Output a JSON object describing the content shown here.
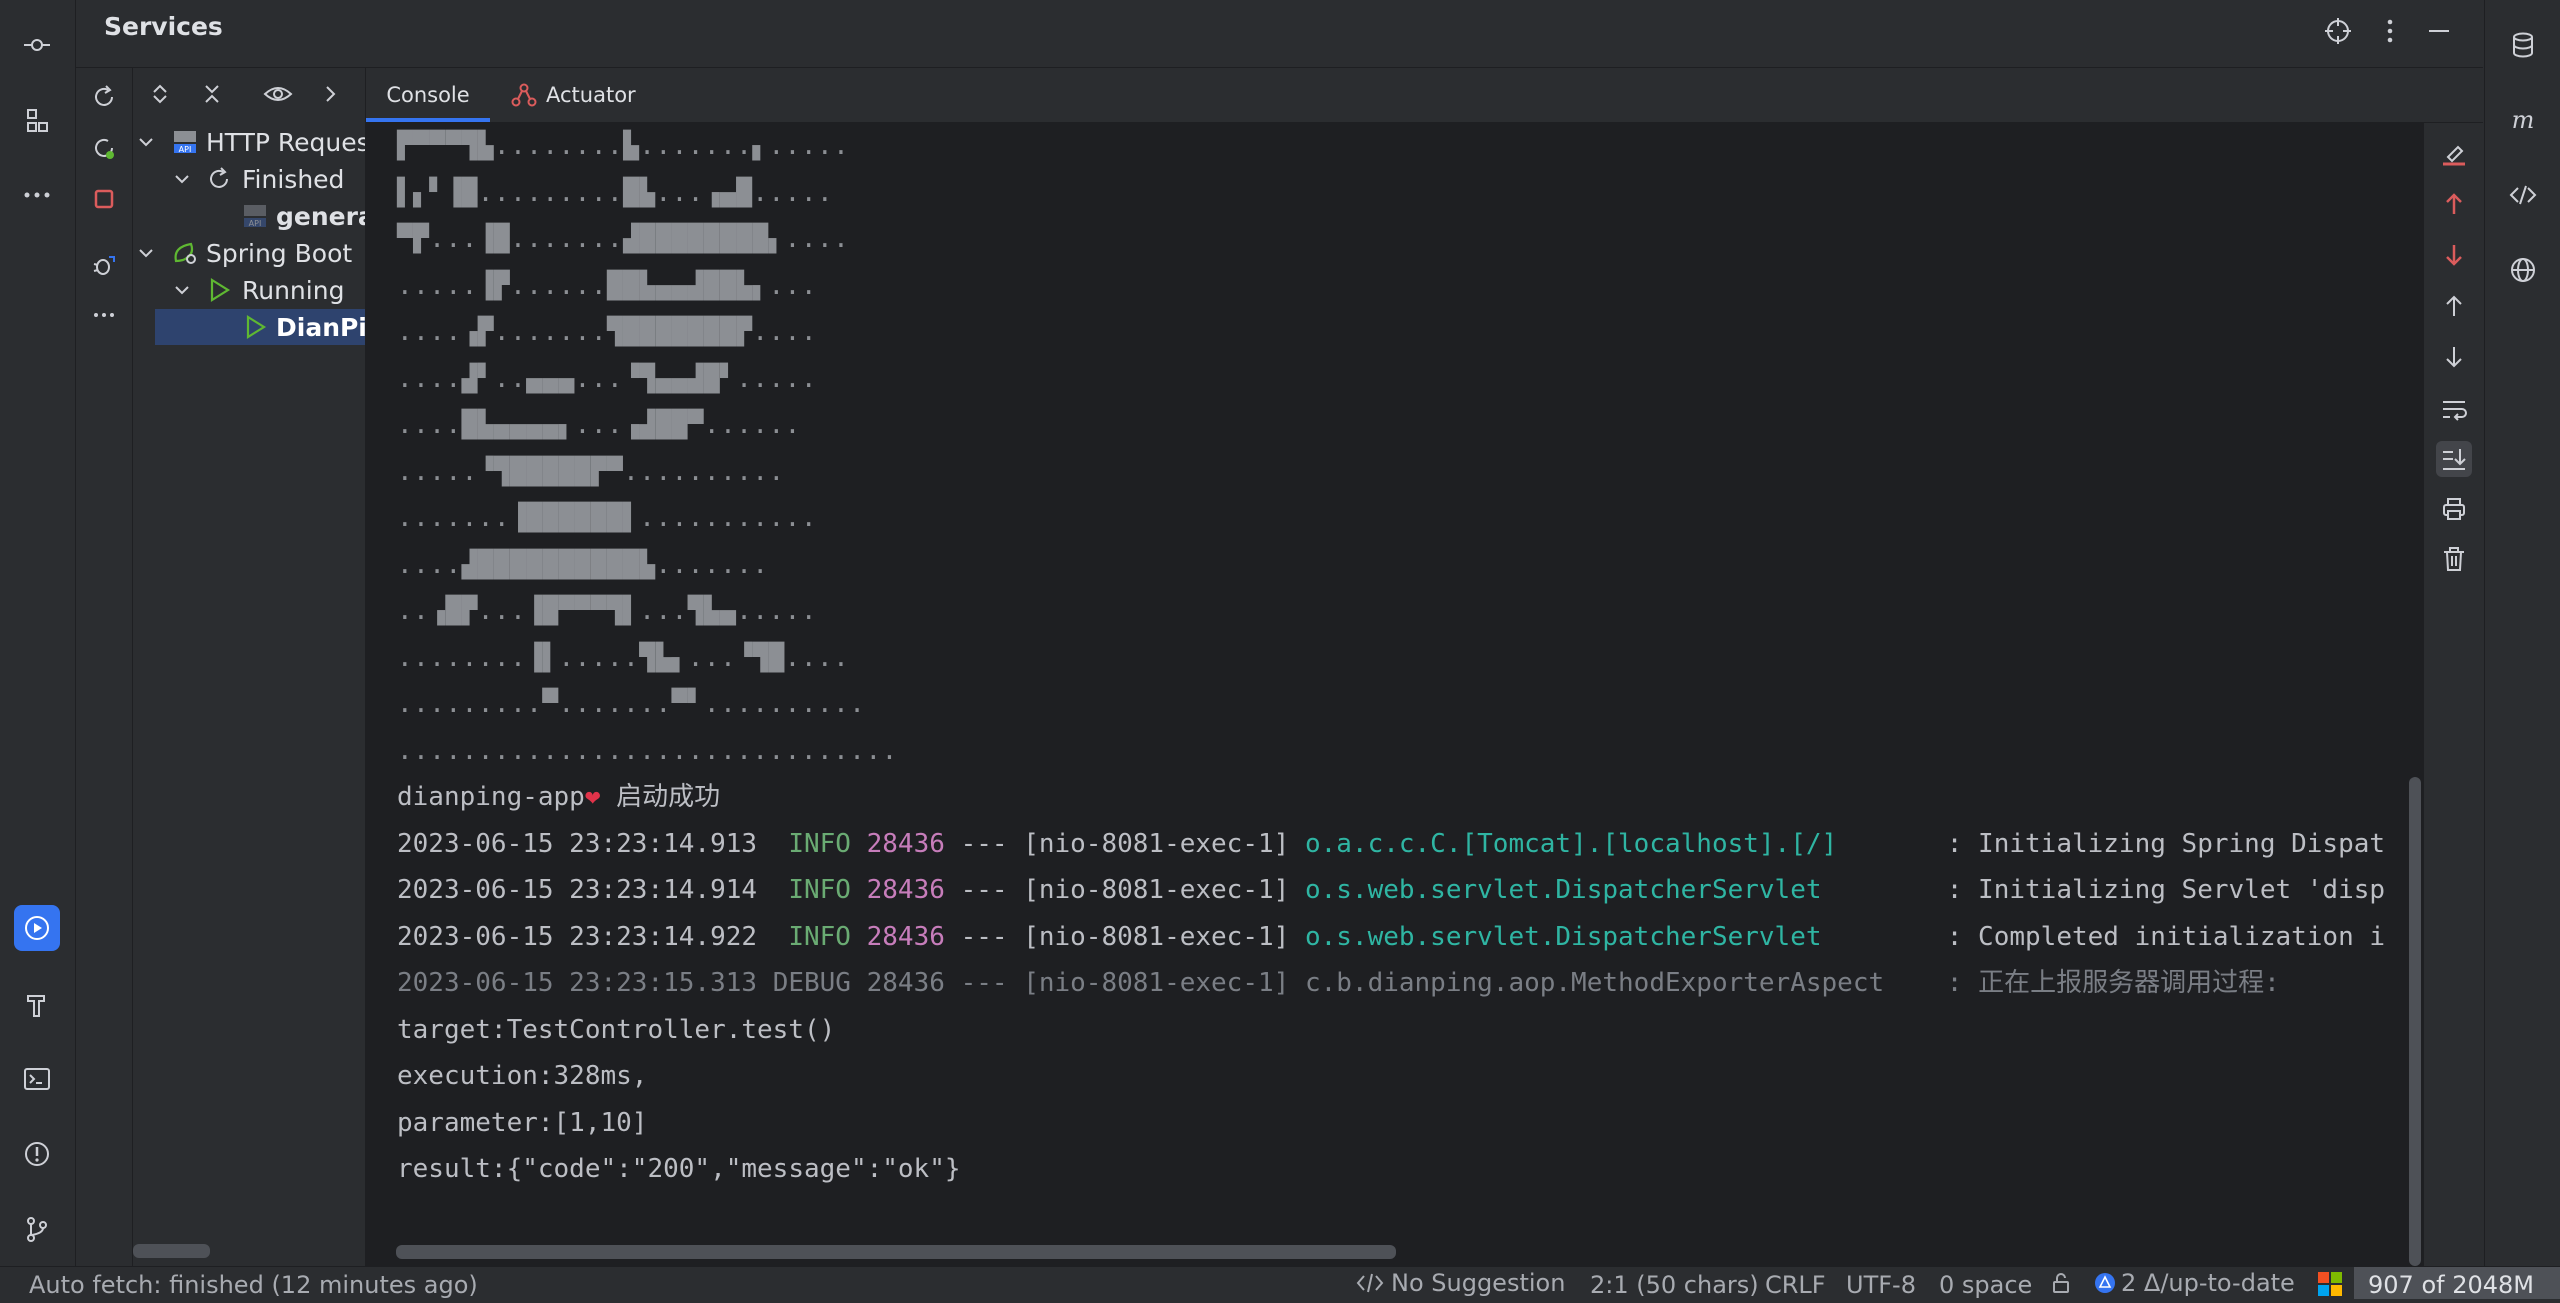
{
  "services": {
    "title": "Services",
    "tree": [
      {
        "label": "HTTP Request",
        "icon": "api-icon"
      },
      {
        "label": "Finished",
        "icon": "refresh-icon"
      },
      {
        "label": "generated-requests",
        "icon": "api-icon"
      },
      {
        "label": "Spring Boot",
        "icon": "spring-boot-icon"
      },
      {
        "label": "Running",
        "icon": "run-icon"
      },
      {
        "label": "DianPingApplication",
        "icon": "run-icon"
      }
    ]
  },
  "tabs": [
    {
      "label": "Console",
      "active": true
    },
    {
      "label": "Actuator",
      "active": false
    }
  ],
  "console": {
    "banner": [
      "▛▀▀▀▜▙........▙.......▖.....",
      "▌▖▘▐█.........█▙...▗▄█.....",
      "▀▛...▐█.......▟████████▖....",
      ".....▐▛......██▙▄▄▟██▙▖...",
      "....▗▛.......▜███████▛....",
      "....▟▘..▄▄▄...▝▜▄▄▟█▘.....",
      "....█▙▄▄▄▄▖...▗▟██▀......",
      ".....▝▜█████▛▀..........",
      ".......▐██████▌...........",
      "....▟██████████▙.......",
      "..▗█▛...▐█▀▀▀▜▌...▜▙▄.....",
      "........▐▌.....▜▙▖...▝▜█....",
      ".........▀.......▀▘..........",
      "..............................."
    ],
    "app_line": {
      "name": "dianping-app",
      "heart": "❤",
      "message": "启动成功"
    },
    "logs": [
      {
        "time": "2023-06-15 23:23:14.913",
        "level": "INFO",
        "pid": "28436",
        "sep": "---",
        "thread": "[nio-8081-exec-1]",
        "logger": "o.a.c.c.C.[Tomcat].[localhost].[/]",
        "message": ": Initializing Spring Dispat"
      },
      {
        "time": "2023-06-15 23:23:14.914",
        "level": "INFO",
        "pid": "28436",
        "sep": "---",
        "thread": "[nio-8081-exec-1]",
        "logger": "o.s.web.servlet.DispatcherServlet",
        "message": ": Initializing Servlet 'disp"
      },
      {
        "time": "2023-06-15 23:23:14.922",
        "level": "INFO",
        "pid": "28436",
        "sep": "---",
        "thread": "[nio-8081-exec-1]",
        "logger": "o.s.web.servlet.DispatcherServlet",
        "message": ": Completed initialization i"
      },
      {
        "time": "2023-06-15 23:23:15.313",
        "level": "DEBUG",
        "pid": "28436",
        "sep": "---",
        "thread": "[nio-8081-exec-1]",
        "logger": "c.b.dianping.aop.MethodExporterAspect",
        "message": ": 正在上报服务器调用过程:"
      }
    ],
    "details": [
      "target:TestController.test()",
      "execution:328ms,",
      "parameter:[1,10]",
      "result:{\"code\":\"200\",\"message\":\"ok\"}"
    ]
  },
  "status_bar": {
    "auto_fetch": "Auto fetch: finished (12 minutes ago)",
    "suggestion": "No Suggestion",
    "position": "2:1 (50 chars)",
    "line_sep": "CRLF",
    "encoding": "UTF-8",
    "indent": "0 space",
    "vcs": "2 Δ/up-to-date",
    "memory": "907 of 2048M"
  },
  "colors": {
    "accent": "#3574f0",
    "info": "#6aab73",
    "pid": "#c77dbb",
    "logger": "#2fb5a3",
    "stop": "#db5c5c",
    "spring": "#5fb832"
  }
}
